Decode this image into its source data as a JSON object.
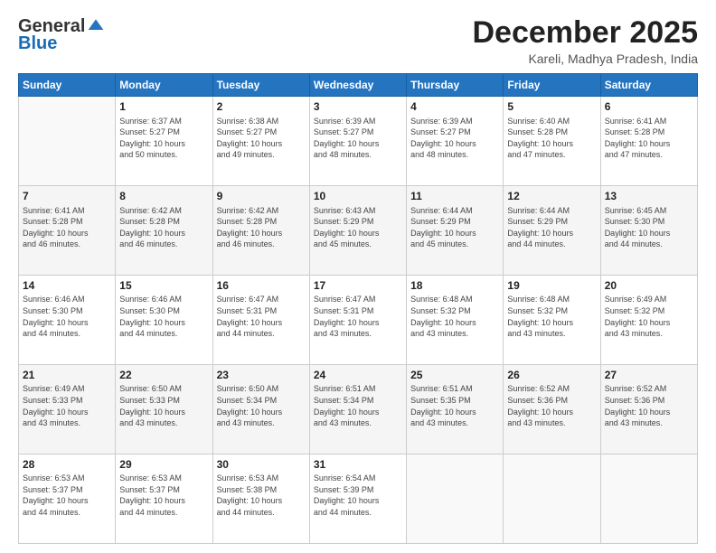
{
  "header": {
    "logo_general": "General",
    "logo_blue": "Blue",
    "title": "December 2025",
    "location": "Kareli, Madhya Pradesh, India"
  },
  "days_of_week": [
    "Sunday",
    "Monday",
    "Tuesday",
    "Wednesday",
    "Thursday",
    "Friday",
    "Saturday"
  ],
  "weeks": [
    [
      {
        "day": "",
        "info": ""
      },
      {
        "day": "1",
        "info": "Sunrise: 6:37 AM\nSunset: 5:27 PM\nDaylight: 10 hours\nand 50 minutes."
      },
      {
        "day": "2",
        "info": "Sunrise: 6:38 AM\nSunset: 5:27 PM\nDaylight: 10 hours\nand 49 minutes."
      },
      {
        "day": "3",
        "info": "Sunrise: 6:39 AM\nSunset: 5:27 PM\nDaylight: 10 hours\nand 48 minutes."
      },
      {
        "day": "4",
        "info": "Sunrise: 6:39 AM\nSunset: 5:27 PM\nDaylight: 10 hours\nand 48 minutes."
      },
      {
        "day": "5",
        "info": "Sunrise: 6:40 AM\nSunset: 5:28 PM\nDaylight: 10 hours\nand 47 minutes."
      },
      {
        "day": "6",
        "info": "Sunrise: 6:41 AM\nSunset: 5:28 PM\nDaylight: 10 hours\nand 47 minutes."
      }
    ],
    [
      {
        "day": "7",
        "info": "Sunrise: 6:41 AM\nSunset: 5:28 PM\nDaylight: 10 hours\nand 46 minutes."
      },
      {
        "day": "8",
        "info": "Sunrise: 6:42 AM\nSunset: 5:28 PM\nDaylight: 10 hours\nand 46 minutes."
      },
      {
        "day": "9",
        "info": "Sunrise: 6:42 AM\nSunset: 5:28 PM\nDaylight: 10 hours\nand 46 minutes."
      },
      {
        "day": "10",
        "info": "Sunrise: 6:43 AM\nSunset: 5:29 PM\nDaylight: 10 hours\nand 45 minutes."
      },
      {
        "day": "11",
        "info": "Sunrise: 6:44 AM\nSunset: 5:29 PM\nDaylight: 10 hours\nand 45 minutes."
      },
      {
        "day": "12",
        "info": "Sunrise: 6:44 AM\nSunset: 5:29 PM\nDaylight: 10 hours\nand 44 minutes."
      },
      {
        "day": "13",
        "info": "Sunrise: 6:45 AM\nSunset: 5:30 PM\nDaylight: 10 hours\nand 44 minutes."
      }
    ],
    [
      {
        "day": "14",
        "info": "Sunrise: 6:46 AM\nSunset: 5:30 PM\nDaylight: 10 hours\nand 44 minutes."
      },
      {
        "day": "15",
        "info": "Sunrise: 6:46 AM\nSunset: 5:30 PM\nDaylight: 10 hours\nand 44 minutes."
      },
      {
        "day": "16",
        "info": "Sunrise: 6:47 AM\nSunset: 5:31 PM\nDaylight: 10 hours\nand 44 minutes."
      },
      {
        "day": "17",
        "info": "Sunrise: 6:47 AM\nSunset: 5:31 PM\nDaylight: 10 hours\nand 43 minutes."
      },
      {
        "day": "18",
        "info": "Sunrise: 6:48 AM\nSunset: 5:32 PM\nDaylight: 10 hours\nand 43 minutes."
      },
      {
        "day": "19",
        "info": "Sunrise: 6:48 AM\nSunset: 5:32 PM\nDaylight: 10 hours\nand 43 minutes."
      },
      {
        "day": "20",
        "info": "Sunrise: 6:49 AM\nSunset: 5:32 PM\nDaylight: 10 hours\nand 43 minutes."
      }
    ],
    [
      {
        "day": "21",
        "info": "Sunrise: 6:49 AM\nSunset: 5:33 PM\nDaylight: 10 hours\nand 43 minutes."
      },
      {
        "day": "22",
        "info": "Sunrise: 6:50 AM\nSunset: 5:33 PM\nDaylight: 10 hours\nand 43 minutes."
      },
      {
        "day": "23",
        "info": "Sunrise: 6:50 AM\nSunset: 5:34 PM\nDaylight: 10 hours\nand 43 minutes."
      },
      {
        "day": "24",
        "info": "Sunrise: 6:51 AM\nSunset: 5:34 PM\nDaylight: 10 hours\nand 43 minutes."
      },
      {
        "day": "25",
        "info": "Sunrise: 6:51 AM\nSunset: 5:35 PM\nDaylight: 10 hours\nand 43 minutes."
      },
      {
        "day": "26",
        "info": "Sunrise: 6:52 AM\nSunset: 5:36 PM\nDaylight: 10 hours\nand 43 minutes."
      },
      {
        "day": "27",
        "info": "Sunrise: 6:52 AM\nSunset: 5:36 PM\nDaylight: 10 hours\nand 43 minutes."
      }
    ],
    [
      {
        "day": "28",
        "info": "Sunrise: 6:53 AM\nSunset: 5:37 PM\nDaylight: 10 hours\nand 44 minutes."
      },
      {
        "day": "29",
        "info": "Sunrise: 6:53 AM\nSunset: 5:37 PM\nDaylight: 10 hours\nand 44 minutes."
      },
      {
        "day": "30",
        "info": "Sunrise: 6:53 AM\nSunset: 5:38 PM\nDaylight: 10 hours\nand 44 minutes."
      },
      {
        "day": "31",
        "info": "Sunrise: 6:54 AM\nSunset: 5:39 PM\nDaylight: 10 hours\nand 44 minutes."
      },
      {
        "day": "",
        "info": ""
      },
      {
        "day": "",
        "info": ""
      },
      {
        "day": "",
        "info": ""
      }
    ]
  ]
}
